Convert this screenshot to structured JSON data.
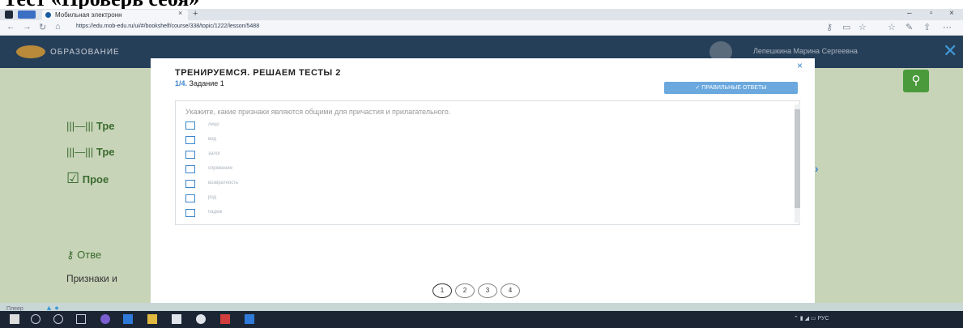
{
  "heading": {
    "text": "Тест «Проверь себя»"
  },
  "browser": {
    "tab_title": "Мобильная электронн",
    "tab_close": "×",
    "new_tab": "+",
    "url": "https://edu.mob-edu.ru/ui/#/bookshelf/course/338/topic/1222/lesson/5488",
    "nav": {
      "back": "←",
      "forward": "→",
      "reload": "↻",
      "home": "⌂"
    },
    "window_controls": {
      "minimize": "–",
      "maximize": "▫",
      "close": "×"
    }
  },
  "site": {
    "logo_text": "ОБРАЗОВАНИЕ",
    "user_name": "Лепешкина Марина Сергеевна",
    "header_close": "✕",
    "search_icon": "⚲",
    "sidebar": [
      {
        "icon": "|||—|||",
        "label": "Тре"
      },
      {
        "icon": "|||—|||",
        "label": "Тре"
      },
      {
        "icon": "☑",
        "label": "Прое"
      }
    ],
    "answer_label": "Отве",
    "answer_text": "Признаки и",
    "footer_text": "Плеер",
    "footer_marks": "▲ ●"
  },
  "modal": {
    "close": "×",
    "title": "ТРЕНИРУЕМСЯ. РЕШАЕМ ТЕСТЫ 2",
    "progress": "1/4.",
    "task_label": "Задание 1",
    "correct_button": "✓ ПРАВИЛЬНЫЕ ОТВЕТЫ",
    "question": "Укажите, какие признаки являются общими для причастия и прилагательного.",
    "options": [
      "лицо",
      "вид",
      "залог",
      "спряжение",
      "возвратность",
      "род",
      "падеж"
    ],
    "next": "›",
    "pages": [
      "1",
      "2",
      "3",
      "4"
    ],
    "current_page": 1
  },
  "colors": {
    "site_bg": "#c7d4b8",
    "header_bg": "#263f59",
    "accent": "#3b86cc",
    "brand_green": "#4a9a3c"
  }
}
